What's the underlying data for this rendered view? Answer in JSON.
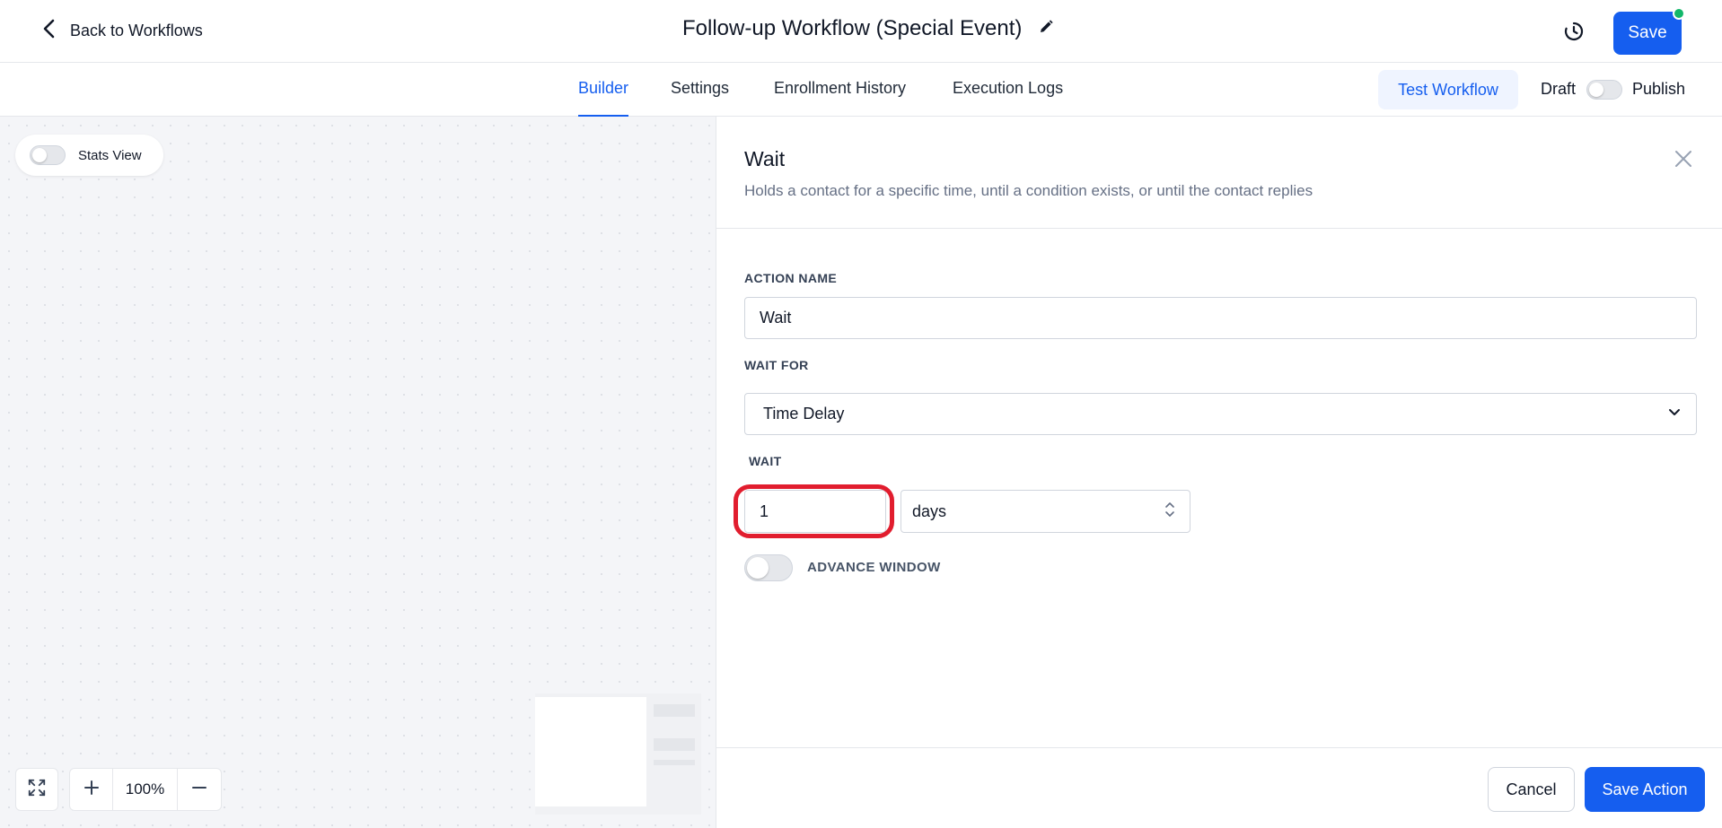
{
  "header": {
    "back_label": "Back to Workflows",
    "title": "Follow-up Workflow (Special Event)",
    "save_label": "Save"
  },
  "tabs": [
    {
      "label": "Builder",
      "active": true
    },
    {
      "label": "Settings",
      "active": false
    },
    {
      "label": "Enrollment History",
      "active": false
    },
    {
      "label": "Execution Logs",
      "active": false
    }
  ],
  "toolbar": {
    "test_label": "Test Workflow",
    "draft_label": "Draft",
    "publish_label": "Publish",
    "publish_on": false
  },
  "canvas": {
    "stats_label": "Stats View",
    "stats_on": false,
    "zoom": "100%"
  },
  "panel": {
    "title": "Wait",
    "description": "Holds a contact for a specific time, until a condition exists, or until the contact replies",
    "action_name_label": "ACTION NAME",
    "action_name_value": "Wait",
    "wait_for_label": "WAIT FOR",
    "wait_for_value": "Time Delay",
    "wait_label": "WAIT",
    "wait_amount": "1",
    "wait_unit": "days",
    "advance_window_label": "ADVANCE WINDOW",
    "advance_window_on": false,
    "cancel_label": "Cancel",
    "save_action_label": "Save Action"
  },
  "colors": {
    "primary": "#155eef",
    "highlight": "#e11d2e",
    "status_dot": "#12b76a"
  }
}
